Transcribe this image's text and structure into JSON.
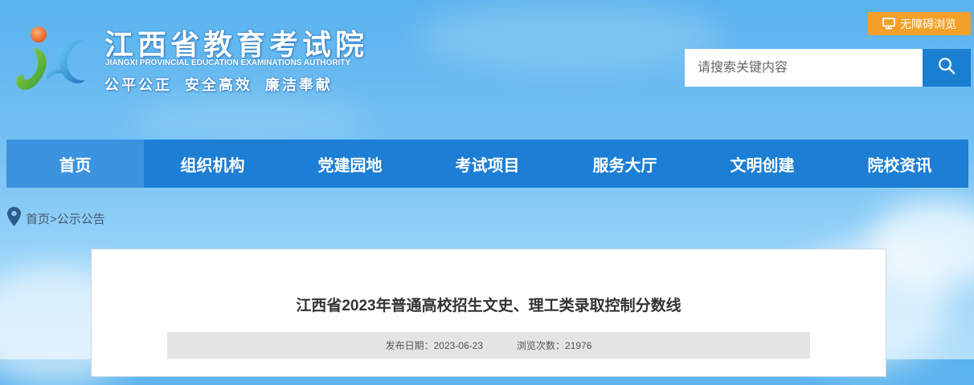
{
  "header": {
    "site_title": "江西省教育考试院",
    "site_subtitle": "JIANGXI PROVINCIAL EDUCATION EXAMINATIONS AUTHORITY",
    "slogan": "公平公正  安全高效  廉洁奉献",
    "logo_icon": "jx-logo-icon"
  },
  "accessibility": {
    "label": "无障碍浏览",
    "icon": "monitor-icon",
    "color": "#f3a028"
  },
  "search": {
    "placeholder": "请搜索关键内容",
    "value": "",
    "icon": "search-icon",
    "button_color": "#1b7fd1"
  },
  "nav": {
    "items": [
      {
        "label": "首页",
        "active": true
      },
      {
        "label": "组织机构"
      },
      {
        "label": "党建园地"
      },
      {
        "label": "考试项目"
      },
      {
        "label": "服务大厅"
      },
      {
        "label": "文明创建"
      },
      {
        "label": "院校资讯"
      }
    ],
    "color": "#1c7ed4",
    "active_color": "#3b93df"
  },
  "breadcrumb": {
    "icon": "location-pin-icon",
    "home": "首页",
    "separator": ">",
    "current": "公示公告"
  },
  "article": {
    "title": "江西省2023年普通高校招生文史、理工类录取控制分数线",
    "publish_label": "发布日期：",
    "publish_date": "2023-06-23",
    "views_label": "浏览次数：",
    "views": "21976"
  }
}
